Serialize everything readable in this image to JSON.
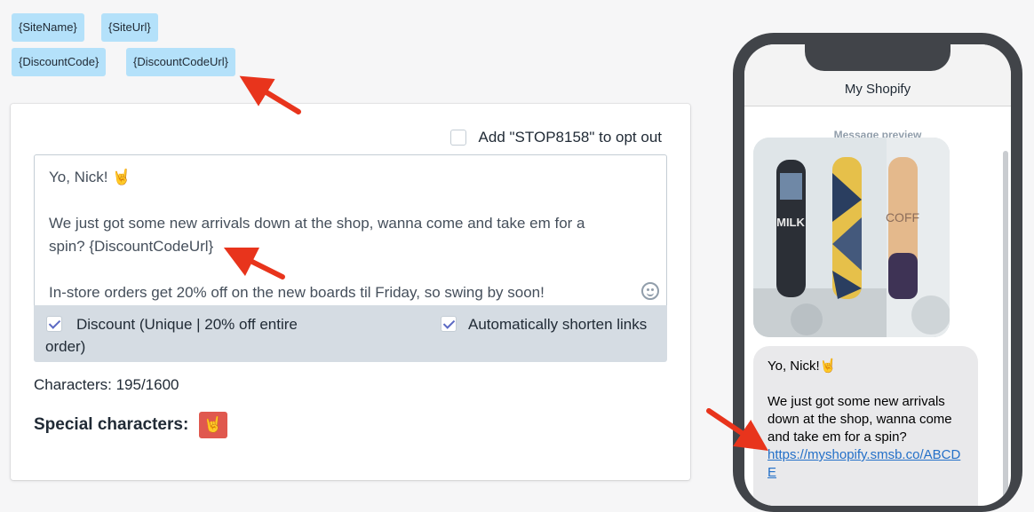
{
  "variables": [
    "{SiteName}",
    "{SiteUrl}",
    "{DiscountCode}",
    "{DiscountCodeUrl}"
  ],
  "editor": {
    "opt_out_label": "Add \"STOP8158\" to opt out",
    "line1": "Yo, Nick! 🤘",
    "line2": "We just got some new arrivals down at the shop, wanna come and take em for a spin? {DiscountCodeUrl}",
    "line3": "In-store orders get 20% off on the new boards til Friday, so swing by soon!",
    "emoji_icon": "smiley-icon"
  },
  "options": {
    "discount_label": "Discount (Unique | 20% off entire order)",
    "discount_checked": true,
    "shorten_label": "Automatically shorten links",
    "shorten_checked": true
  },
  "characters": "Characters: 195/1600",
  "special": {
    "label": "Special characters:",
    "chars": [
      "🤘"
    ],
    "chip_color": "#e0584e"
  },
  "preview": {
    "shop_name": "My Shopify",
    "label": "Message preview",
    "line1": "Yo, Nick!🤘",
    "line2": "We just got some new arrivals down at the shop, wanna come and take em for a spin?",
    "link": "https://myshopify.smsb.co/ABCDE"
  },
  "colors": {
    "tag_bg": "#b4e1fa",
    "accent": "#5c6ac4",
    "arrow": "#e8341c",
    "link": "#2470c8"
  }
}
